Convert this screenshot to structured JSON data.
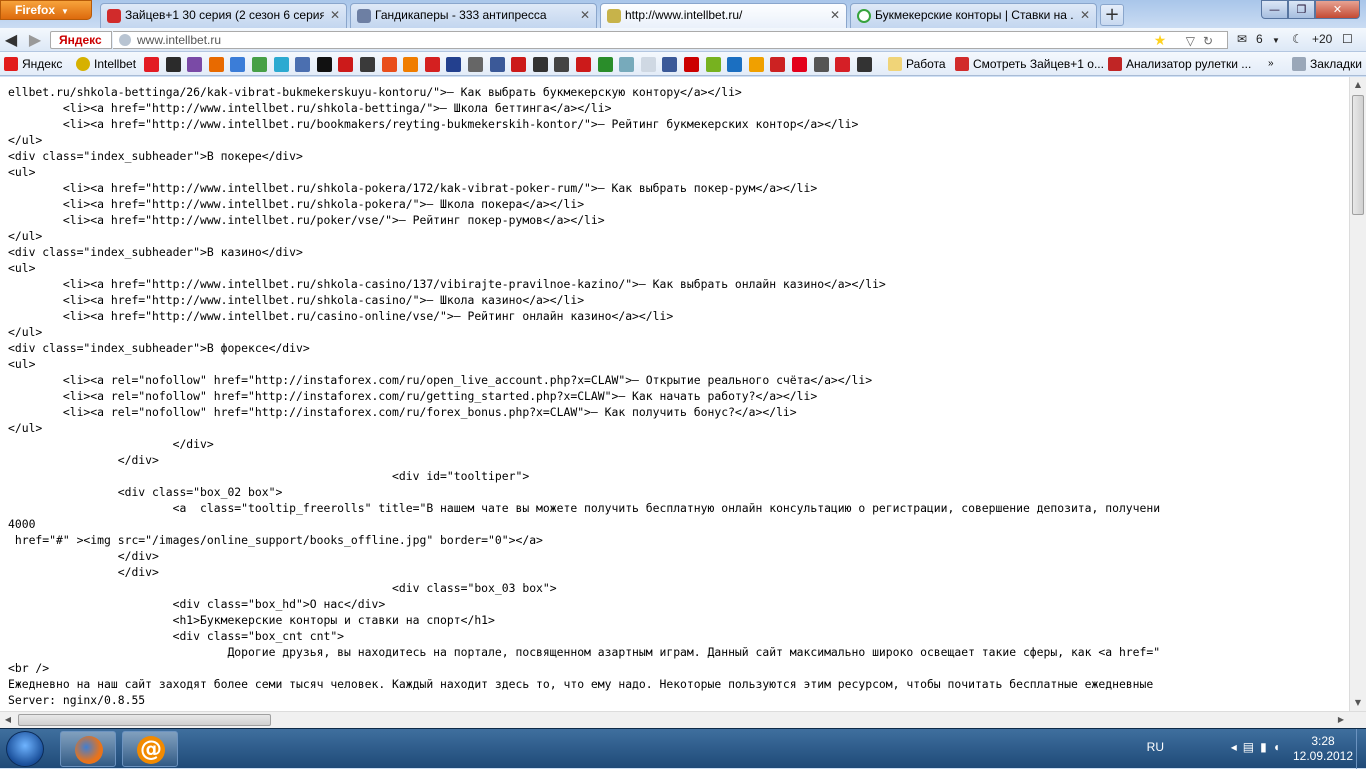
{
  "browser": {
    "menu_button": "Firefox",
    "tabs": [
      {
        "title": "Зайцев+1 30 серия (2 сезон 6 серия)...",
        "favicon_color": "#d12b2b"
      },
      {
        "title": "Гандикаперы - 333 антипресса",
        "favicon_color": "#6d7fa3"
      },
      {
        "title": "http://www.intellbet.ru/",
        "favicon_color": "#c7b34a"
      },
      {
        "title": "Букмекерские конторы | Ставки на ...",
        "favicon_color": "#37a33c"
      }
    ],
    "new_tab_label": "+",
    "window_controls": {
      "minimize": "—",
      "maximize": "❐",
      "close": "✕"
    }
  },
  "navigation": {
    "back_icon": "◀",
    "forward_icon": "▶",
    "search_engine_badge": "Яндекс",
    "url": "www.intellbet.ru",
    "mail_count": "6",
    "weather": "+20"
  },
  "bookmarks": {
    "items": [
      {
        "label": "Яндекс",
        "color": "#e21b1b"
      },
      {
        "label": "Intellbet",
        "color": "#d6b100"
      },
      {
        "label": "Работа",
        "color": "#f0d478"
      },
      {
        "label": "Смотреть Зайцев+1 о...",
        "color": "#d12b2b"
      },
      {
        "label": "Анализатор рулетки ...",
        "color": "#c02525"
      },
      {
        "label": "Закладки",
        "color": "#9aa7b8"
      }
    ],
    "icon_colors": [
      "#e31b23",
      "#2b2b2b",
      "#7a4aa6",
      "#e86a00",
      "#3b7dd8",
      "#47a047",
      "#2caad1",
      "#4b6fb0",
      "#111",
      "#cc1a1a",
      "#3a3a3a",
      "#e94e1b",
      "#f07d00",
      "#d42020",
      "#23408e",
      "#666",
      "#3b5998",
      "#cc1a1a",
      "#333",
      "#444",
      "#cc1a1a",
      "#2a8d2a",
      "#7ab",
      "#cfd8e3",
      "#3b5998",
      "#cc0000",
      "#77b21f",
      "#1b6fc1",
      "#f0a000",
      "#c22",
      "#e3001b",
      "#555",
      "#d51f26",
      "#333"
    ]
  },
  "source_lines": [
    "ellbet.ru/shkola-bettinga/26/kak-vibrat-bukmekerskuyu-kontoru/\">— Как выбрать букмекерскую контору</a></li>",
    "        <li><a href=\"http://www.intellbet.ru/shkola-bettinga/\">— Школа беттинга</a></li>",
    "        <li><a href=\"http://www.intellbet.ru/bookmakers/reyting-bukmekerskih-kontor/\">— Рейтинг букмекерских контор</a></li>",
    "</ul>",
    "<div class=\"index_subheader\">В покере</div>",
    "<ul>",
    "        <li><a href=\"http://www.intellbet.ru/shkola-pokera/172/kak-vibrat-poker-rum/\">— Как выбрать покер-рум</a></li>",
    "        <li><a href=\"http://www.intellbet.ru/shkola-pokera/\">— Школа покера</a></li>",
    "        <li><a href=\"http://www.intellbet.ru/poker/vse/\">— Рейтинг покер-румов</a></li>",
    "</ul>",
    "<div class=\"index_subheader\">В казино</div>",
    "<ul>",
    "        <li><a href=\"http://www.intellbet.ru/shkola-casino/137/vibirajte-pravilnoe-kazino/\">— Как выбрать онлайн казино</a></li>",
    "        <li><a href=\"http://www.intellbet.ru/shkola-casino/\">— Школа казино</a></li>",
    "        <li><a href=\"http://www.intellbet.ru/casino-online/vse/\">— Рейтинг онлайн казино</a></li>",
    "</ul>",
    "<div class=\"index_subheader\">В форексе</div>",
    "<ul>",
    "        <li><a rel=\"nofollow\" href=\"http://instaforex.com/ru/open_live_account.php?x=CLAW\">— Открытие реального счёта</a></li>",
    "        <li><a rel=\"nofollow\" href=\"http://instaforex.com/ru/getting_started.php?x=CLAW\">— Как начать работу?</a></li>",
    "        <li><a rel=\"nofollow\" href=\"http://instaforex.com/ru/forex_bonus.php?x=CLAW\">— Как получить бонус?</a></li>",
    "</ul>",
    "                        </div>",
    "                </div>",
    "                                                        <div id=\"tooltiper\">",
    "                <div class=\"box_02 box\">",
    "                        <a  class=\"tooltip_freerolls\" title=\"В нашем чате вы можете получить бесплатную онлайн консультацию о регистрации, совершение депозита, получени",
    "4000",
    " href=\"#\" ><img src=\"/images/online_support/books_offline.jpg\" border=\"0\"></a>",
    "                </div>",
    "                </div>",
    "                                                        <div class=\"box_03 box\">",
    "                        <div class=\"box_hd\">О нас</div>",
    "                        <h1>Букмекерские конторы и ставки на спорт</h1>",
    "                        <div class=\"box_cnt cnt\">",
    "                                Дорогие друзья, вы находитесь на портале, посвященном азартным играм. Данный сайт максимально широко освещает такие сферы, как <a href=\"",
    "<br />",
    "Ежедневно на наш сайт заходят более семи тысяч человек. Каждый находит здесь то, что ему надо. Некоторые пользуются этим ресурсом, чтобы почитать бесплатные ежедневные",
    "Server: nginx/0.8.55"
  ],
  "taskbar": {
    "language": "RU",
    "time": "3:28",
    "date": "12.09.2012"
  }
}
